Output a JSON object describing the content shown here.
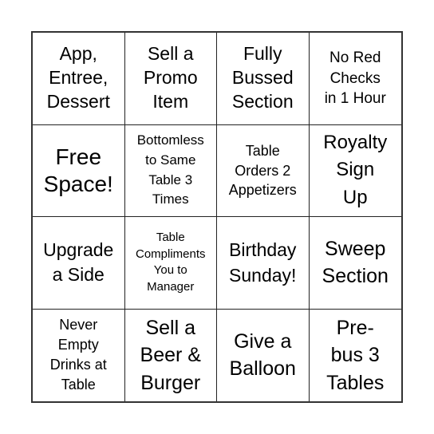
{
  "card": {
    "cells": [
      {
        "text": "App, Entree, Dessert",
        "lines": [
          "App,",
          "Entree,",
          "Dessert"
        ]
      },
      {
        "text": "Sell a Promo Item",
        "lines": [
          "Sell a",
          "Promo",
          "Item"
        ]
      },
      {
        "text": "Fully Bussed Section",
        "lines": [
          "Fully",
          "Bussed",
          "Section"
        ]
      },
      {
        "text": "No Red Checks in 1 Hour",
        "lines": [
          "No Red",
          "Checks",
          "in 1 Hour"
        ]
      },
      {
        "text": "Free Space!",
        "lines": [
          "Free",
          "Space!"
        ]
      },
      {
        "text": "Bottomless to Same Table 3 Times",
        "lines": [
          "Bottomless",
          "to Same",
          "Table 3",
          "Times"
        ]
      },
      {
        "text": "Table Orders 2 Appetizers",
        "lines": [
          "Table",
          "Orders 2",
          "Appetizers"
        ]
      },
      {
        "text": "Royalty Sign Up",
        "lines": [
          "Royalty",
          "Sign",
          "Up"
        ]
      },
      {
        "text": "Upgrade a Side",
        "lines": [
          "Upgrade",
          "a Side"
        ]
      },
      {
        "text": "Table Compliments You to Manager",
        "lines": [
          "Table",
          "Compliments",
          "You to",
          "Manager"
        ]
      },
      {
        "text": "Birthday Sunday!",
        "lines": [
          "Birthday",
          "Sunday!"
        ]
      },
      {
        "text": "Sweep Section",
        "lines": [
          "Sweep",
          "Section"
        ]
      },
      {
        "text": "Never Empty Drinks at Table",
        "lines": [
          "Never",
          "Empty",
          "Drinks at",
          "Table"
        ]
      },
      {
        "text": "Sell a Beer & Burger",
        "lines": [
          "Sell a",
          "Beer &",
          "Burger"
        ]
      },
      {
        "text": "Give a Balloon",
        "lines": [
          "Give a",
          "Balloon"
        ]
      },
      {
        "text": "Pre-bus 3 Tables",
        "lines": [
          "Pre-",
          "bus 3",
          "Tables"
        ]
      }
    ]
  }
}
